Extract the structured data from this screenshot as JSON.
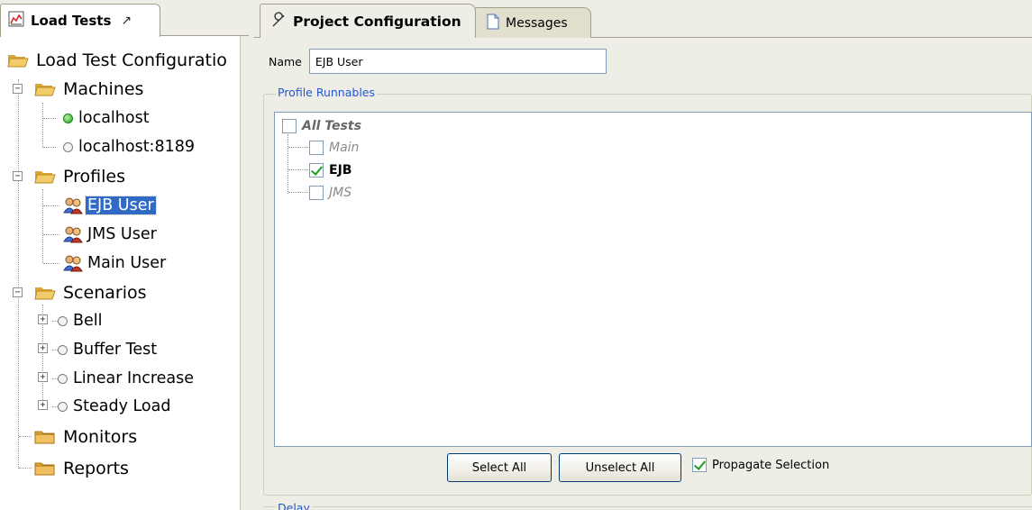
{
  "left_panel": {
    "tab_label": "Load Tests",
    "pin_glyph": "↗",
    "tree": {
      "root": "Load Test Configuratio",
      "machines": {
        "label": "Machines",
        "items": [
          "localhost",
          "localhost:8189"
        ],
        "item_status": [
          "online",
          "offline"
        ]
      },
      "profiles": {
        "label": "Profiles",
        "items": [
          "EJB User",
          "JMS User",
          "Main User"
        ],
        "selected": "EJB User"
      },
      "scenarios": {
        "label": "Scenarios",
        "items": [
          "Bell",
          "Buffer Test",
          "Linear Increase",
          "Steady Load"
        ]
      },
      "monitors": "Monitors",
      "reports": "Reports"
    }
  },
  "right_panel": {
    "tabs": [
      {
        "label": "Project Configuration",
        "icon": "wrench-icon",
        "active": true
      },
      {
        "label": "Messages",
        "icon": "document-icon",
        "active": false
      }
    ],
    "name_label": "Name",
    "name_value": "EJB User",
    "runnables": {
      "title": "Profile Runnables",
      "root": {
        "label": "All Tests",
        "checked": false
      },
      "items": [
        {
          "label": "Main",
          "checked": false
        },
        {
          "label": "EJB",
          "checked": true
        },
        {
          "label": "JMS",
          "checked": false
        }
      ]
    },
    "buttons": {
      "select_all": "Select All",
      "unselect_all": "Unselect All"
    },
    "propagate": {
      "label": "Propagate Selection",
      "checked": true
    },
    "delay_title": "Delay"
  },
  "colors": {
    "selection": "#316ac5",
    "group_title": "#2255cc",
    "online": "#25a51c",
    "folder": "#e8b84a"
  }
}
